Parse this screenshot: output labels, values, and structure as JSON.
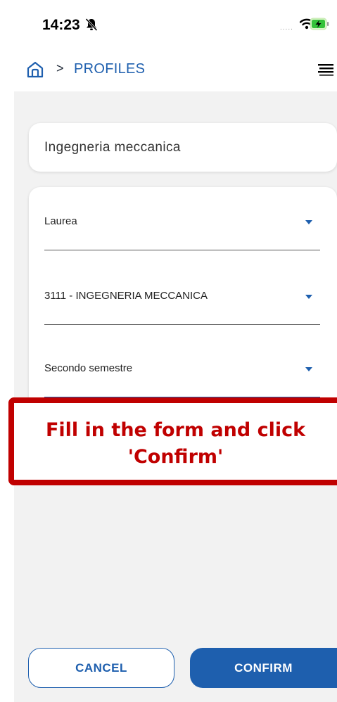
{
  "status_bar": {
    "time": "14:23",
    "signal_dots": "....."
  },
  "nav": {
    "separator": ">",
    "breadcrumb": "PROFILES"
  },
  "title_card": {
    "text": "Ingegneria meccanica"
  },
  "form": {
    "fields": [
      {
        "value": "Laurea"
      },
      {
        "value": "3111 - INGEGNERIA MECCANICA"
      },
      {
        "value": "Secondo semestre"
      }
    ]
  },
  "overlay": {
    "line1": "Fill in the form and click",
    "line2": "'Confirm'",
    "color": "#c00000"
  },
  "buttons": {
    "cancel": "CANCEL",
    "confirm": "CONFIRM"
  },
  "colors": {
    "accent": "#1e5fae",
    "background": "#f2f2f2"
  }
}
